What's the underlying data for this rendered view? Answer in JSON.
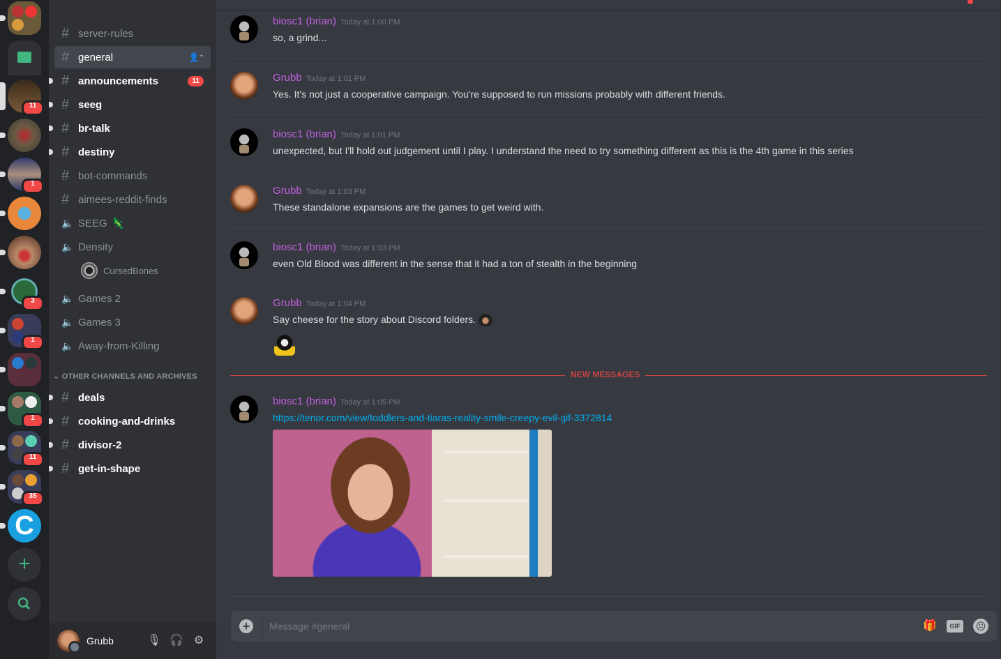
{
  "servers": [
    {
      "name": "folder-1",
      "badge": null
    },
    {
      "name": "folder-green",
      "badge": null
    },
    {
      "name": "chuf-la",
      "badge": "11"
    },
    {
      "name": "zombie",
      "badge": null
    },
    {
      "name": "the-zone",
      "badge": "1"
    },
    {
      "name": "orange-server",
      "badge": null
    },
    {
      "name": "superman-server",
      "badge": null
    },
    {
      "name": "globe-server",
      "badge": "3"
    },
    {
      "name": "folder-dark",
      "badge": "1"
    },
    {
      "name": "folder-maroon",
      "badge": null
    },
    {
      "name": "folder-teal",
      "badge": "1"
    },
    {
      "name": "folder-nerd",
      "badge": "11"
    },
    {
      "name": "folder-mixed",
      "badge": "35"
    },
    {
      "name": "c-server",
      "letter": "C",
      "badge": null
    }
  ],
  "rail_actions": {
    "add_server": "+",
    "explore": "⌕"
  },
  "channels": {
    "text": [
      {
        "name": "server-rules",
        "unread": false
      },
      {
        "name": "general",
        "unread": false,
        "selected": true
      },
      {
        "name": "announcements",
        "unread": true,
        "badge": "11"
      },
      {
        "name": "seeg",
        "unread": true
      },
      {
        "name": "br-talk",
        "unread": true
      },
      {
        "name": "destiny",
        "unread": true
      },
      {
        "name": "bot-commands",
        "unread": false
      },
      {
        "name": "aimees-reddit-finds",
        "unread": false
      }
    ],
    "voice": [
      {
        "name": "SEEG",
        "emoji": "🦎"
      },
      {
        "name": "Density",
        "users": [
          "CursedBones"
        ]
      },
      {
        "name": "Games 2"
      },
      {
        "name": "Games 3"
      },
      {
        "name": "Away-from-Killing"
      }
    ],
    "category": "OTHER CHANNELS AND ARCHIVES",
    "archived": [
      {
        "name": "deals"
      },
      {
        "name": "cooking-and-drinks"
      },
      {
        "name": "divisor-2"
      },
      {
        "name": "get-in-shape"
      }
    ]
  },
  "user_panel": {
    "username": "Grubb",
    "status": "offline"
  },
  "chat": {
    "channel": "general",
    "messages": [
      {
        "author": "biosc1 (brian)",
        "time": "Today at 1:00 PM",
        "text": "so, a grind..."
      },
      {
        "author": "Grubb",
        "time": "Today at 1:01 PM",
        "text": "Yes. It's not just a cooperative campaign. You're supposed to run missions probably with different friends."
      },
      {
        "author": "biosc1 (brian)",
        "time": "Today at 1:01 PM",
        "text": "unexpected, but I'll hold out judgement until I play.  I understand the need to try something different as this is the 4th game in this series"
      },
      {
        "author": "Grubb",
        "time": "Today at 1:03 PM",
        "text": "These standalone expansions are the games to get weird with."
      },
      {
        "author": "biosc1 (brian)",
        "time": "Today at 1:03 PM",
        "text": "even Old Blood was different in the sense that it had a ton of stealth in the beginning"
      },
      {
        "author": "Grubb",
        "time": "Today at 1:04 PM",
        "text": "Say cheese for the story about Discord folders."
      },
      {
        "author": "biosc1 (brian)",
        "time": "Today at 1:05 PM",
        "link": "https://tenor.com/view/toddlers-and-tiaras-reality-smile-creepy-evil-gif-3372814"
      }
    ],
    "new_messages_label": "NEW MESSAGES",
    "composer_placeholder": "Message #general",
    "gif_label": "GIF"
  },
  "colors": {
    "accent_name": "#c161e0",
    "mention_red": "#f04747",
    "link": "#00b0f4"
  }
}
